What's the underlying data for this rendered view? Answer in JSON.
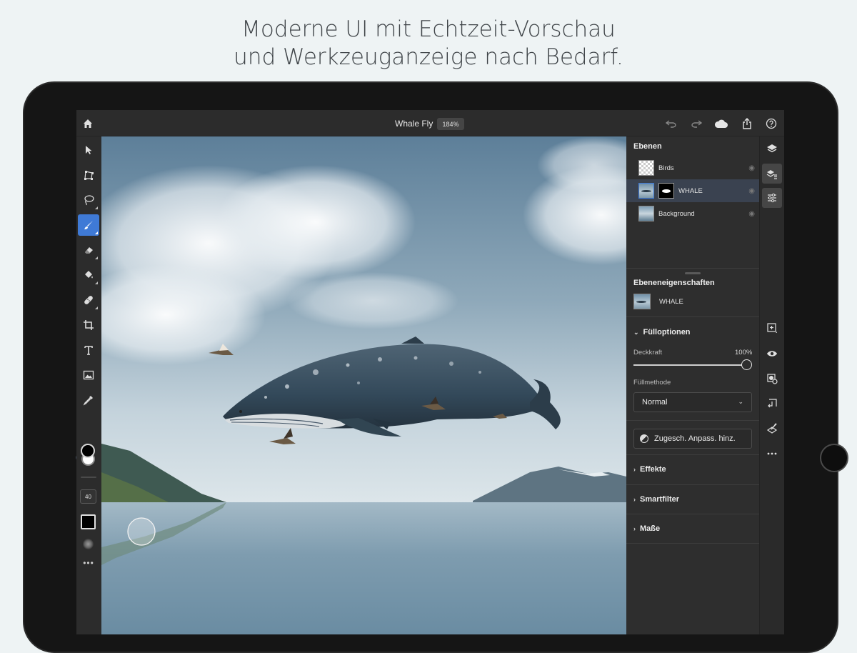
{
  "headline": {
    "line1": "Moderne UI mit Echtzeit-Vorschau",
    "line2": "und Werkzeuganzeige nach Bedarf."
  },
  "topbar": {
    "doc_title": "Whale Fly",
    "zoom": "184%",
    "icons": [
      "home-icon",
      "undo-icon",
      "redo-icon",
      "cloud-icon",
      "share-icon",
      "help-icon"
    ]
  },
  "toolbar": {
    "tools": [
      "select-tool",
      "transform-tool",
      "lasso-tool",
      "brush-tool",
      "eraser-tool",
      "fill-tool",
      "healing-tool",
      "crop-tool",
      "type-tool",
      "place-image-tool",
      "eyedropper-tool"
    ],
    "active_tool": "brush-tool",
    "brush_size": "40",
    "more": "•••"
  },
  "layers": {
    "title": "Ebenen",
    "items": [
      {
        "name": "Birds",
        "selected": false
      },
      {
        "name": "WHALE",
        "selected": true
      },
      {
        "name": "Background",
        "selected": false
      }
    ]
  },
  "properties": {
    "title": "Ebeneneigenschaften",
    "layer_name": "WHALE",
    "fill_options": "Fülloptionen",
    "opacity_label": "Deckkraft",
    "opacity_value": "100%",
    "opacity": 1.0,
    "blend_label": "Füllmethode",
    "blend_mode": "Normal",
    "adjust_button": "Zugesch. Anpass. hinz.",
    "sections": [
      "Effekte",
      "Smartfilter",
      "Maße"
    ]
  },
  "colors": {
    "accent": "#3f7ad6",
    "panel": "#2e2e2e",
    "foreground": "#000000",
    "background": "#ffffff"
  }
}
